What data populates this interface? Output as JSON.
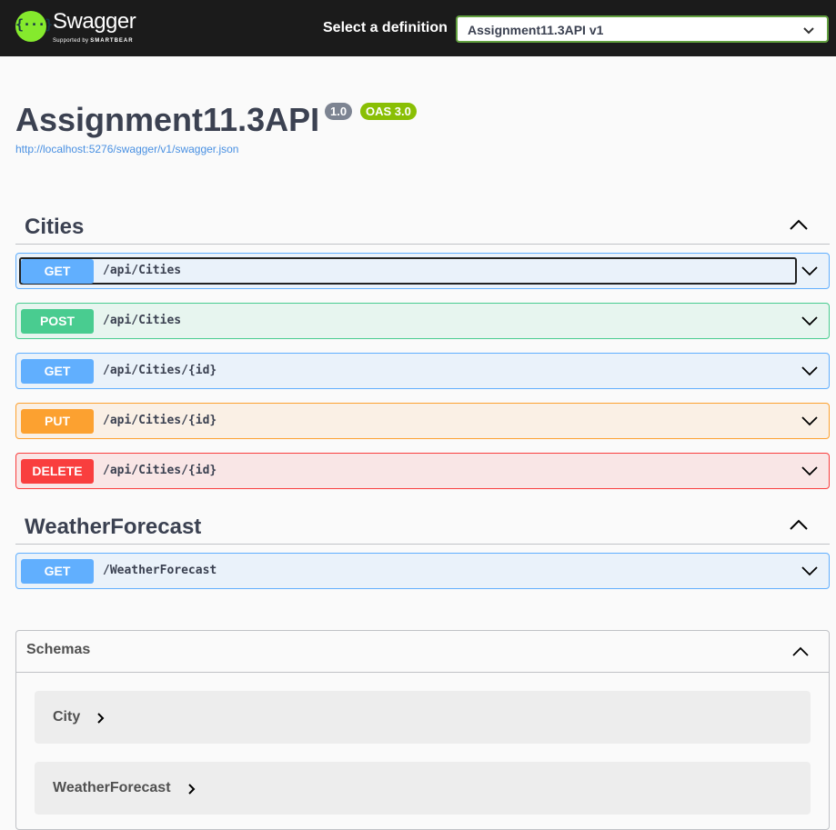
{
  "topbar": {
    "logo_glyph": "{···}",
    "logo_word": "Swagger",
    "logo_sub_prefix": "Supported by",
    "logo_sub_brand": "SMARTBEAR",
    "select_label": "Select a definition",
    "select_value": "Assignment11.3API v1",
    "accent_color": "#85ea2d"
  },
  "info": {
    "title": "Assignment11.3API",
    "version_badge": "1.0",
    "oas_badge": "OAS 3.0",
    "spec_url": "http://localhost:5276/swagger/v1/swagger.json"
  },
  "tags": [
    {
      "name": "Cities",
      "operations": [
        {
          "method": "GET",
          "path": "/api/Cities"
        },
        {
          "method": "POST",
          "path": "/api/Cities"
        },
        {
          "method": "GET",
          "path": "/api/Cities/{id}"
        },
        {
          "method": "PUT",
          "path": "/api/Cities/{id}"
        },
        {
          "method": "DELETE",
          "path": "/api/Cities/{id}"
        }
      ]
    },
    {
      "name": "WeatherForecast",
      "operations": [
        {
          "method": "GET",
          "path": "/WeatherForecast"
        }
      ]
    }
  ],
  "schemas": {
    "title": "Schemas",
    "models": [
      "City",
      "WeatherForecast"
    ]
  },
  "colors": {
    "get": "#61affe",
    "post": "#49cc90",
    "put": "#fca130",
    "delete": "#f93e3e"
  },
  "icons": {
    "collapse": "chevron-up-icon",
    "expand": "chevron-down-icon",
    "model_expand": "chevron-right-icon"
  }
}
